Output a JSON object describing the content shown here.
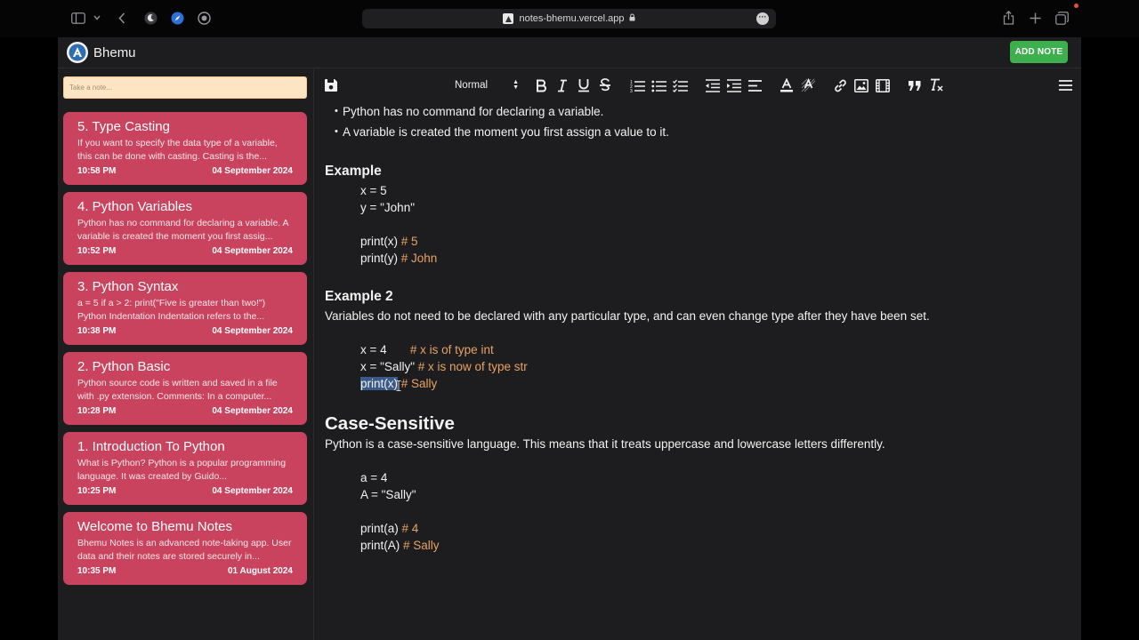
{
  "browser": {
    "url": "notes-bhemu.vercel.app"
  },
  "app": {
    "name": "Bhemu",
    "add_note_label": "ADD NOTE",
    "search_placeholder": "Take a note..."
  },
  "notes": [
    {
      "title": "5. Type Casting",
      "body": "If you want to specify the data type of a variable, this can be done with casting. Casting is the...",
      "time": "10:58 PM",
      "date": "04 September 2024"
    },
    {
      "title": "4. Python Variables",
      "body": "Python has no command for declaring a variable. A variable is created the moment you first assig...",
      "time": "10:52 PM",
      "date": "04 September 2024"
    },
    {
      "title": "3. Python Syntax",
      "body": "a = 5 if a > 2: print(\"Five is greater than two!\") Python Indentation Indentation refers to the...",
      "time": "10:38 PM",
      "date": "04 September 2024"
    },
    {
      "title": "2. Python Basic",
      "body": "Python source code is written and saved in a file with .py extension. Comments: In a computer...",
      "time": "10:28 PM",
      "date": "04 September 2024"
    },
    {
      "title": "1. Introduction To Python",
      "body": "What is Python? Python is a popular programming language. It was created by Guido...",
      "time": "10:25 PM",
      "date": "04 September 2024"
    },
    {
      "title": "Welcome to Bhemu Notes",
      "body": "Bhemu Notes is an advanced note-taking app. User data and their notes are stored securely in...",
      "time": "10:35 PM",
      "date": "01 August 2024"
    }
  ],
  "editor": {
    "format_select": "Normal",
    "bullets": [
      "Python has no command for declaring a variable.",
      "A variable is created the moment you first assign a value to it."
    ],
    "example_heading": "Example",
    "example_code": {
      "l1": "x = 5",
      "l2": "y = \"John\"",
      "l3_code": "print(x) ",
      "l3_comment": "# 5",
      "l4_code": "print(y) ",
      "l4_comment": "# John"
    },
    "example2_heading": "Example 2",
    "example2_text": "Variables do not need to be declared with any particular type, and can even change type after they have been set.",
    "example2_code": {
      "l1_code": "x = 4       ",
      "l1_comment": "# x is of type int",
      "l2_code": "x = \"Sally\" ",
      "l2_comment": "# x is now of type str",
      "l3_code_selected": "print(x)",
      "l3_code_rest": " ",
      "l3_comment": "# Sally"
    },
    "case_heading": "Case-Sensitive",
    "case_text": "Python is a case-sensitive language. This means that it treats uppercase and lowercase letters differently.",
    "case_code": {
      "l1": "a = 4",
      "l2": "A = \"Sally\"",
      "l3_code": "print(a) ",
      "l3_comment": "# 4",
      "l4_code": "print(A) ",
      "l4_comment": "# Sally"
    }
  }
}
